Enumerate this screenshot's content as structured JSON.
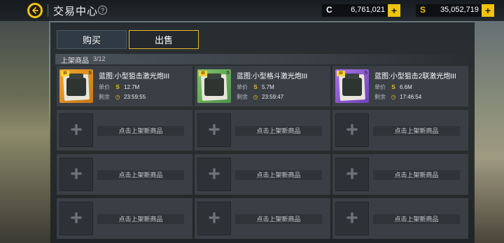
{
  "header": {
    "title": "交易中心",
    "help_label": "?"
  },
  "currencies": [
    {
      "symbol": "C",
      "amount": "6,761,021",
      "add_label": "+"
    },
    {
      "symbol": "S",
      "amount": "35,052,719",
      "add_label": "+"
    }
  ],
  "tabs": {
    "buy": "购买",
    "sell": "出售"
  },
  "section": {
    "label": "上架商品",
    "count": "3/12"
  },
  "listings": [
    {
      "name": "蓝图:小型狙击激光炮III",
      "price_label": "单价",
      "price_icon": "S",
      "price": "12.7M",
      "time_label": "剩余",
      "time": "23:59:55",
      "color": "#f3a32a"
    },
    {
      "name": "蓝图:小型格斗激光炮III",
      "price_label": "单价",
      "price_icon": "S",
      "price": "5.7M",
      "time_label": "剩余",
      "time": "23:59:47",
      "color": "#7fc26b"
    },
    {
      "name": "蓝图:小型狙击2联激光炮III",
      "price_label": "单价",
      "price_icon": "S",
      "price": "6.6M",
      "time_label": "剩余",
      "time": "17:46:54",
      "color": "#a672e8"
    }
  ],
  "empty_slot": {
    "plus": "+",
    "hint": "点击上架新商品"
  },
  "colors": {
    "accent": "#f1c30f",
    "panel": "#1e2226"
  }
}
